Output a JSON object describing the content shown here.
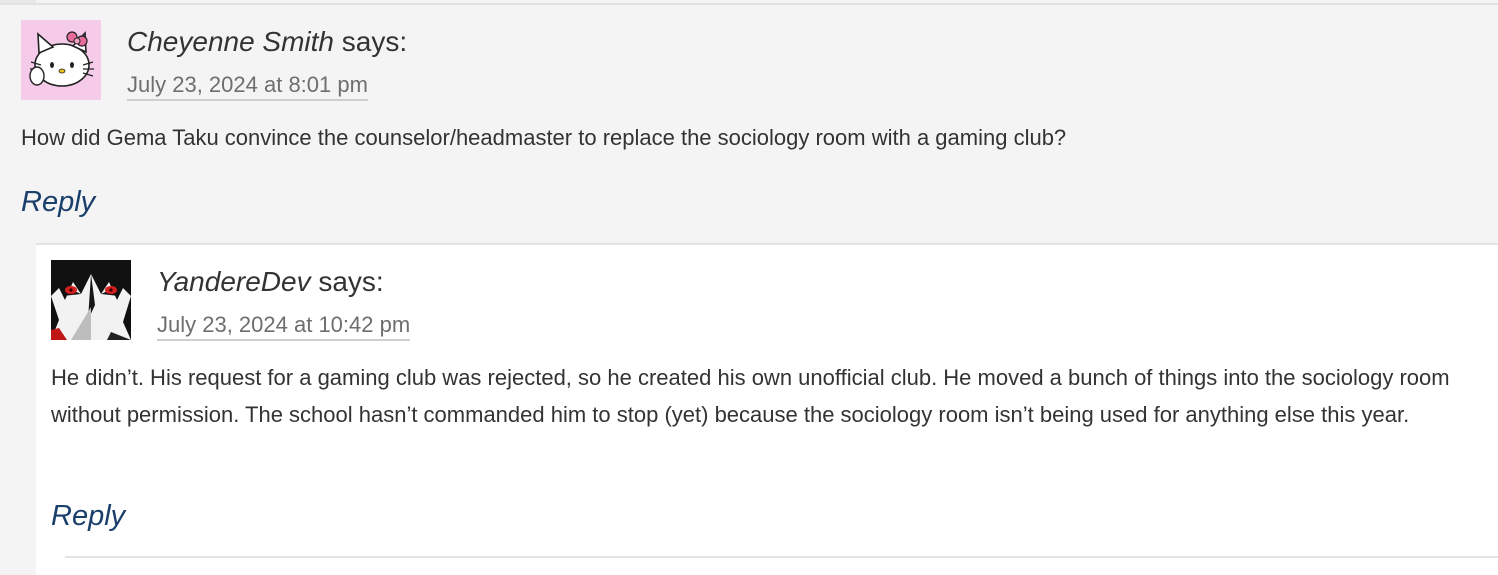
{
  "comments": [
    {
      "author": "Cheyenne Smith",
      "says": "says:",
      "date": "July 23, 2024 at 8:01 pm",
      "body": "How did Gema Taku convince the counselor/headmaster to replace the sociology room with a gaming club?",
      "reply_label": "Reply",
      "avatar_icon": "hello-kitty-avatar",
      "avatar_bg": "#f6cbe9"
    },
    {
      "author": "YandereDev",
      "says": "says:",
      "date": "July 23, 2024 at 10:42 pm",
      "body": "He didn’t. His request for a gaming club was rejected, so he created his own unofficial club. He moved a bunch of things into the sociology room without permission. The school hasn’t commanded him to stop (yet) because the sociology room isn’t being used for anything else this year.",
      "reply_label": "Reply",
      "avatar_icon": "anime-character-avatar",
      "avatar_bg": "#111111"
    }
  ],
  "colors": {
    "link": "#1b3f6b",
    "page_bg": "#f4f4f4",
    "child_bg": "#ffffff",
    "date": "#6e6e6e"
  }
}
